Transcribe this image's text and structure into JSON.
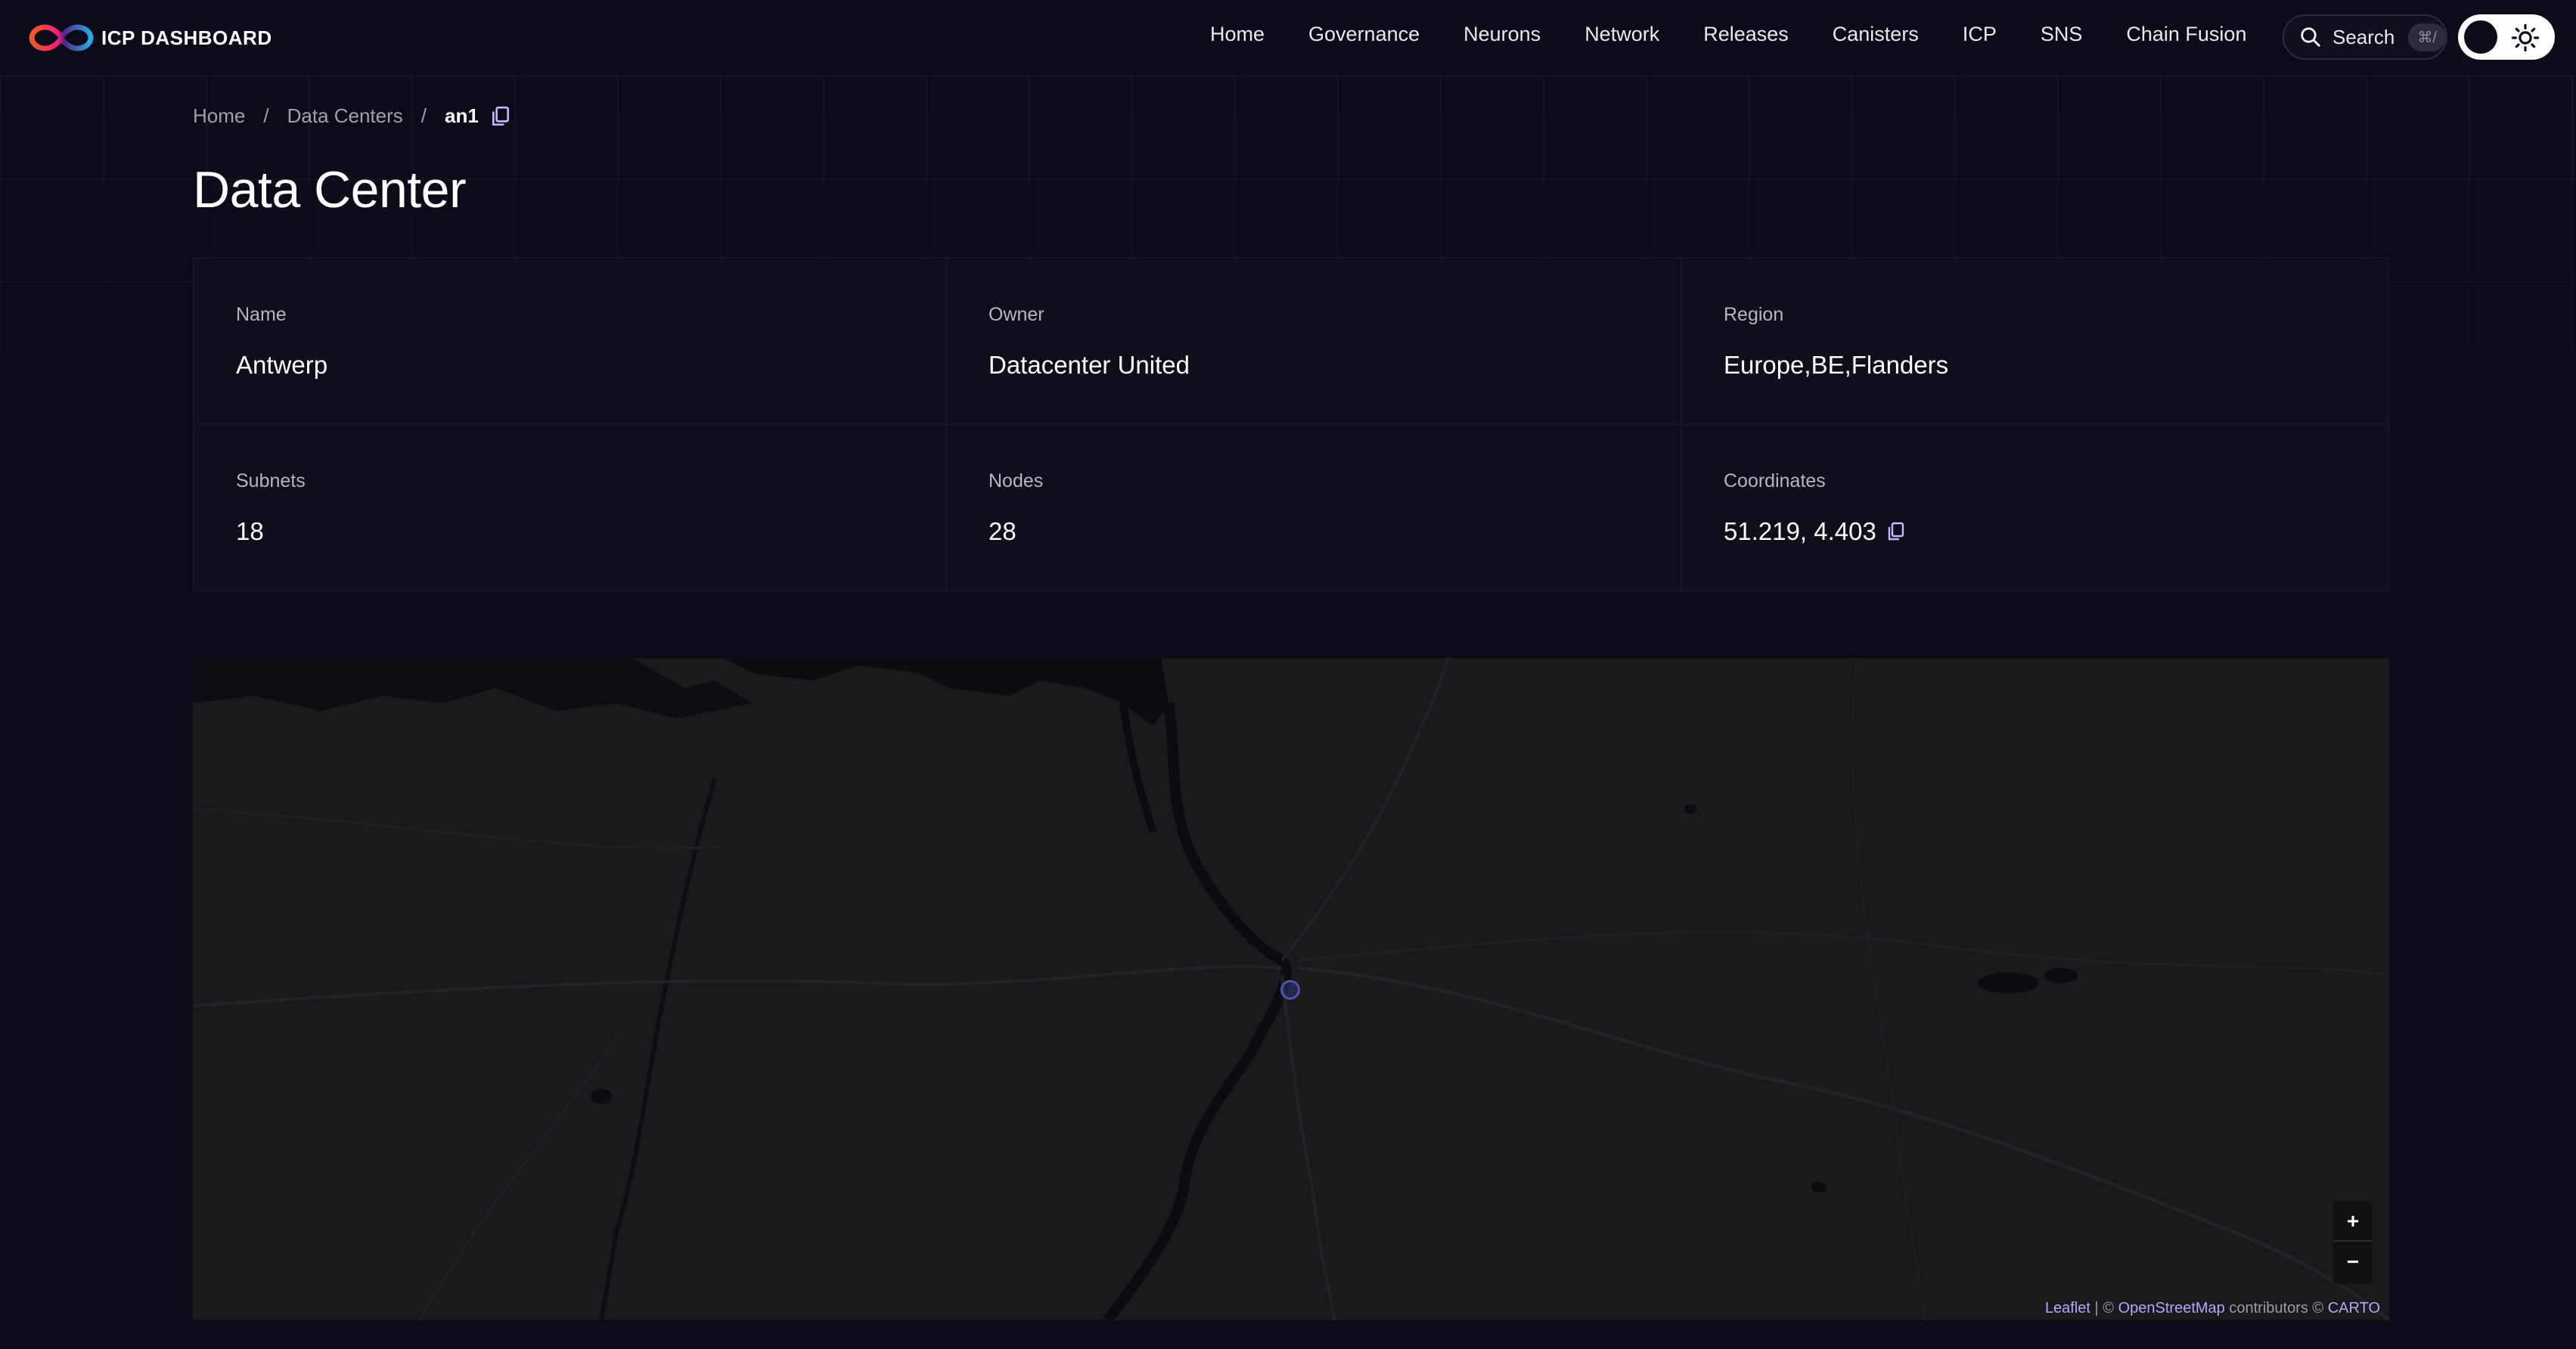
{
  "header": {
    "logo_text": "ICP DASHBOARD",
    "nav": [
      "Home",
      "Governance",
      "Neurons",
      "Network",
      "Releases",
      "Canisters",
      "ICP",
      "SNS",
      "Chain Fusion"
    ],
    "search_label": "Search",
    "search_shortcut": "⌘/"
  },
  "breadcrumb": {
    "items": [
      "Home",
      "Data Centers"
    ],
    "separator": "/",
    "current": "an1"
  },
  "page": {
    "title": "Data Center"
  },
  "details": {
    "name": {
      "label": "Name",
      "value": "Antwerp"
    },
    "owner": {
      "label": "Owner",
      "value": "Datacenter United"
    },
    "region": {
      "label": "Region",
      "value": "Europe,BE,Flanders"
    },
    "subnets": {
      "label": "Subnets",
      "value": "18"
    },
    "nodes": {
      "label": "Nodes",
      "value": "28"
    },
    "coordinates": {
      "label": "Coordinates",
      "value": "51.219, 4.403"
    }
  },
  "map": {
    "zoom_in": "+",
    "zoom_out": "−",
    "attribution": {
      "leaflet": "Leaflet",
      "sep1": " | © ",
      "osm": "OpenStreetMap",
      "contributors": " contributors © ",
      "carto": "CARTO"
    }
  },
  "colors": {
    "background": "#0b0b1a",
    "card": "#0e0e1c",
    "map_land": "#1a1a1d",
    "map_water": "#0b0b12",
    "accent_link": "#b9a3ff",
    "marker": "#4c56a8"
  },
  "icons": [
    "infinity-logo-icon",
    "search-icon",
    "moon-toggle-icon",
    "sun-icon",
    "copy-icon"
  ]
}
